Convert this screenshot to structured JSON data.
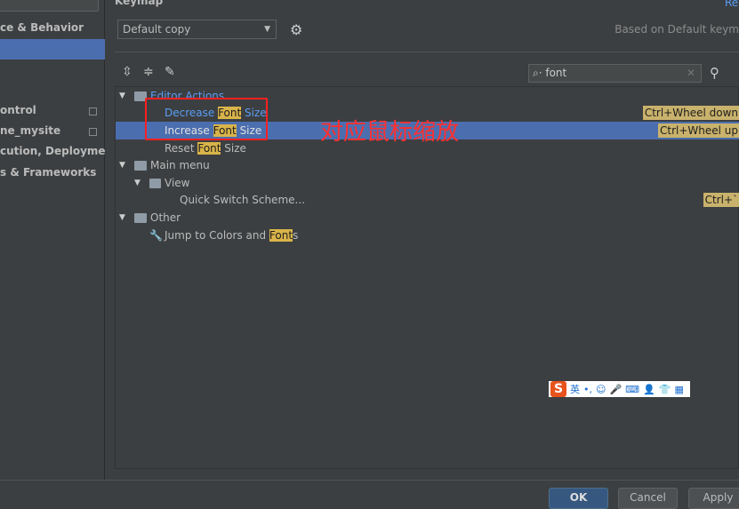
{
  "sidebar": {
    "items": [
      {
        "label": "ce & Behavior"
      },
      {
        "label": ""
      },
      {
        "label": "ontrol"
      },
      {
        "label": "ne_mysite"
      },
      {
        "label": "cution, Deployment"
      },
      {
        "label": "s & Frameworks"
      }
    ]
  },
  "header": {
    "title": "Keymap",
    "reset_link": "Re",
    "scheme": "Default copy",
    "based_on": "Based on Default keym"
  },
  "search": {
    "value": "font"
  },
  "tree": [
    {
      "label_pre": "Editor Actions",
      "hl": "",
      "label_post": ""
    },
    {
      "label_pre": "Decrease ",
      "hl": "Font",
      "label_post": " Size",
      "shortcut": "Ctrl+Wheel down"
    },
    {
      "label_pre": "Increase ",
      "hl": "Font",
      "label_post": " Size",
      "shortcut": "Ctrl+Wheel up"
    },
    {
      "label_pre": "Reset ",
      "hl": "Font",
      "label_post": " Size"
    },
    {
      "label_pre": "Main menu",
      "hl": "",
      "label_post": ""
    },
    {
      "label_pre": "View",
      "hl": "",
      "label_post": ""
    },
    {
      "label_pre": "Quick Switch Scheme...",
      "hl": "",
      "label_post": "",
      "shortcut": "Ctrl+`"
    },
    {
      "label_pre": "Other",
      "hl": "",
      "label_post": ""
    },
    {
      "label_pre": "Jump to Colors and ",
      "hl": "Font",
      "label_post": "s"
    }
  ],
  "annotation": "对应鼠标缩放",
  "ime": {
    "logo": "S",
    "lang": "英",
    "punct": "•,"
  },
  "buttons": {
    "ok": "OK",
    "cancel": "Cancel",
    "apply": "Apply"
  },
  "colors": {
    "selection": "#4b6eaf",
    "highlight": "#d9b44a",
    "annotation": "#ff2020"
  }
}
